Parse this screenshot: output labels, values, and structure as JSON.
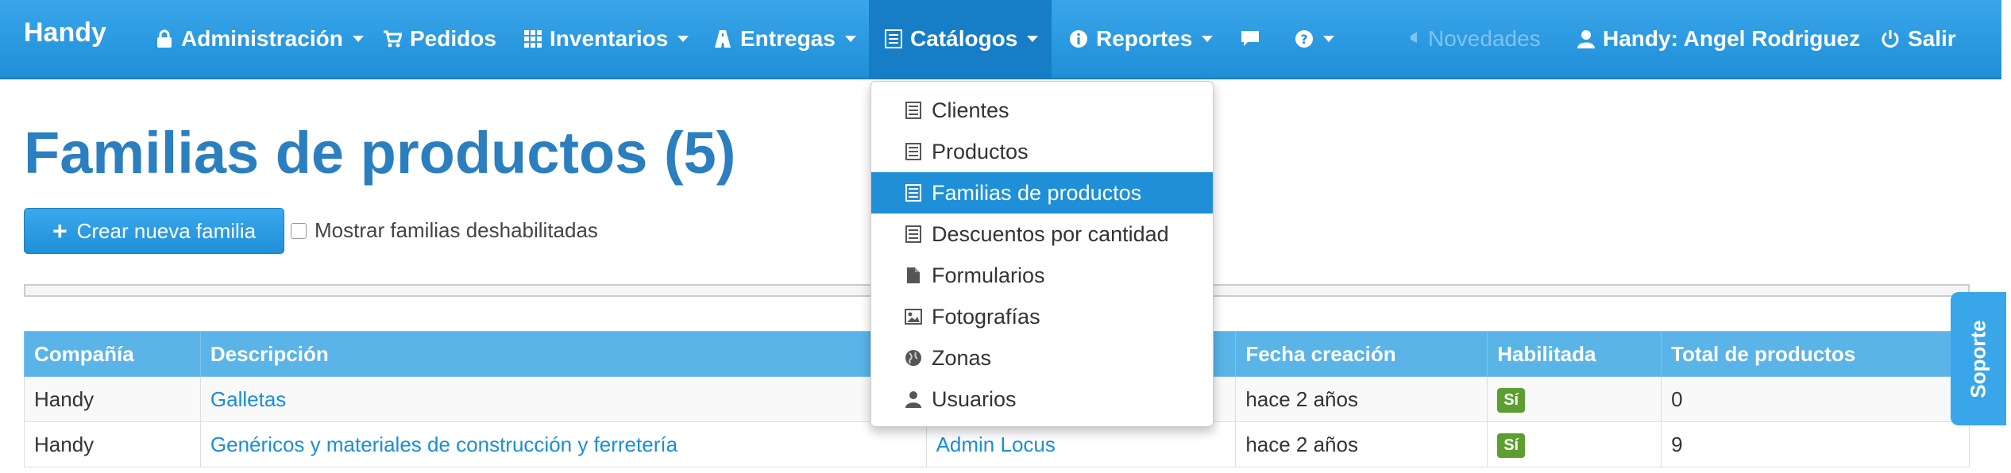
{
  "nav": {
    "brand": "Handy",
    "admin": "Administración",
    "orders": "Pedidos",
    "inventories": "Inventarios",
    "deliveries": "Entregas",
    "catalogs": "Catálogos",
    "reports": "Reportes",
    "news": "Novedades",
    "user": "Handy: Angel Rodriguez",
    "logout": "Salir",
    "icons": [
      "lock-icon",
      "cart-icon",
      "grid-icon",
      "road-icon",
      "list-icon",
      "info-icon",
      "comment-icon",
      "question-icon",
      "bullhorn-icon",
      "user-icon",
      "power-icon"
    ]
  },
  "page": {
    "title": "Familias de productos (5)",
    "create_button": "Crear nueva familia",
    "show_disabled_label": "Mostrar familias deshabilitadas"
  },
  "dropdown": {
    "items": [
      {
        "label": "Clientes",
        "icon": "list-icon"
      },
      {
        "label": "Productos",
        "icon": "list-icon"
      },
      {
        "label": "Familias de productos",
        "icon": "list-icon",
        "active": true
      },
      {
        "label": "Descuentos por cantidad",
        "icon": "list-icon"
      },
      {
        "label": "Formularios",
        "icon": "file-icon"
      },
      {
        "label": "Fotografías",
        "icon": "picture-icon"
      },
      {
        "label": "Zonas",
        "icon": "globe-icon"
      },
      {
        "label": "Usuarios",
        "icon": "user-icon"
      }
    ]
  },
  "table": {
    "headers": [
      "Compañía",
      "Descripción",
      "",
      "Fecha creación",
      "Habilitada",
      "Total de productos"
    ],
    "rows": [
      {
        "company": "Handy",
        "description": "Galletas",
        "creator": "",
        "created": "hace 2 años",
        "enabled": "Sí",
        "total": "0"
      },
      {
        "company": "Handy",
        "description": "Genéricos y materiales de construcción y ferretería",
        "creator": "Admin Locus",
        "created": "hace 2 años",
        "enabled": "Sí",
        "total": "9"
      }
    ]
  },
  "support": {
    "label": "Soporte"
  },
  "colors": {
    "nav": "#1f8fd8",
    "title": "#2b7fbf",
    "link": "#1a8ed8",
    "badge": "#5c9e2f"
  }
}
